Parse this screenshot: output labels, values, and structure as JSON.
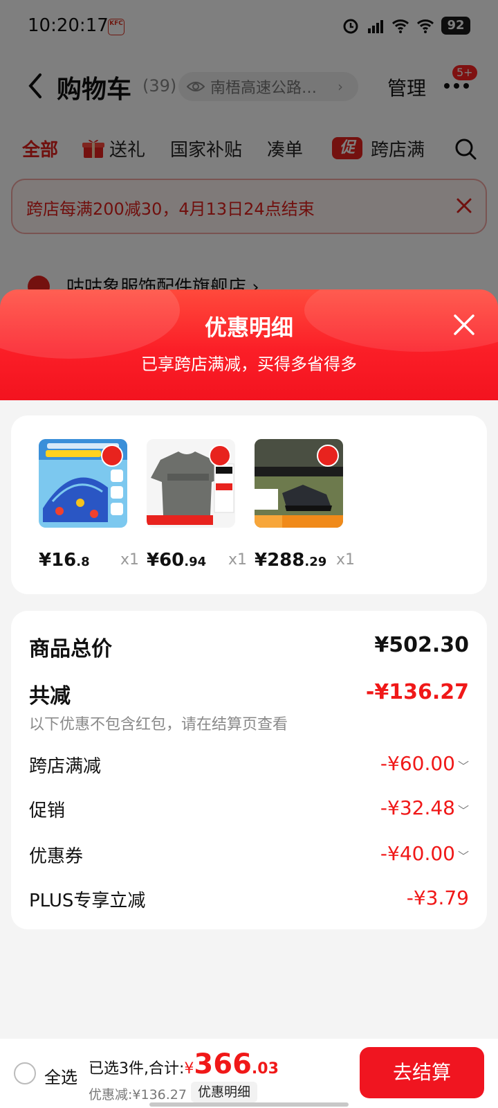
{
  "status_bar": {
    "time": "10:20:17",
    "battery": "92",
    "kfc_label": "KFC"
  },
  "nav": {
    "title": "购物车",
    "count": "(39)",
    "address": "南梧高速公路…",
    "manage": "管理",
    "more_badge": "5+"
  },
  "tabs": {
    "items": [
      {
        "label": "全部"
      },
      {
        "label": "送礼"
      },
      {
        "label": "国家补贴"
      },
      {
        "label": "凑单"
      },
      {
        "label": "跨店满"
      }
    ],
    "promo_icon_text": "促"
  },
  "promo_banner": {
    "text": "跨店每满200减30，4月13日24点结束"
  },
  "shop": {
    "name": "咕咕象服饰配件旗舰店 ›"
  },
  "sheet": {
    "title": "优惠明细",
    "subtitle": "已享跨店满减，买得多省得多"
  },
  "products": [
    {
      "price_int": "¥16",
      "price_dec": ".8",
      "qty": "x1",
      "icon": "umbrella-product"
    },
    {
      "price_int": "¥60",
      "price_dec": ".94",
      "qty": "x1",
      "icon": "tshirt-product"
    },
    {
      "price_int": "¥288",
      "price_dec": ".29",
      "qty": "x1",
      "icon": "shoe-product"
    }
  ],
  "summary": {
    "total_label": "商品总价",
    "total_value": "¥502.30",
    "reduce_label": "共减",
    "reduce_value": "-¥136.27",
    "note": "以下优惠不包含红包，请在结算页查看",
    "items": [
      {
        "label": "跨店满减",
        "value": "-¥60.00",
        "chevron": "﹀"
      },
      {
        "label": "促销",
        "value": "-¥32.48",
        "chevron": "﹀"
      },
      {
        "label": "优惠券",
        "value": "-¥40.00",
        "chevron": "﹀"
      },
      {
        "label": "PLUS专享立减",
        "value": "-¥3.79",
        "chevron": ""
      }
    ]
  },
  "bottom": {
    "select_all": "全选",
    "selected_text": "已选3件,合计:",
    "yen": "¥",
    "amount_int": "366",
    "amount_dec": ".03",
    "discount_text": "优惠减:¥136.27",
    "detail_button": "优惠明细",
    "checkout": "去结算"
  },
  "colors": {
    "accent": "#f01520",
    "promo_red": "#e0201c"
  }
}
